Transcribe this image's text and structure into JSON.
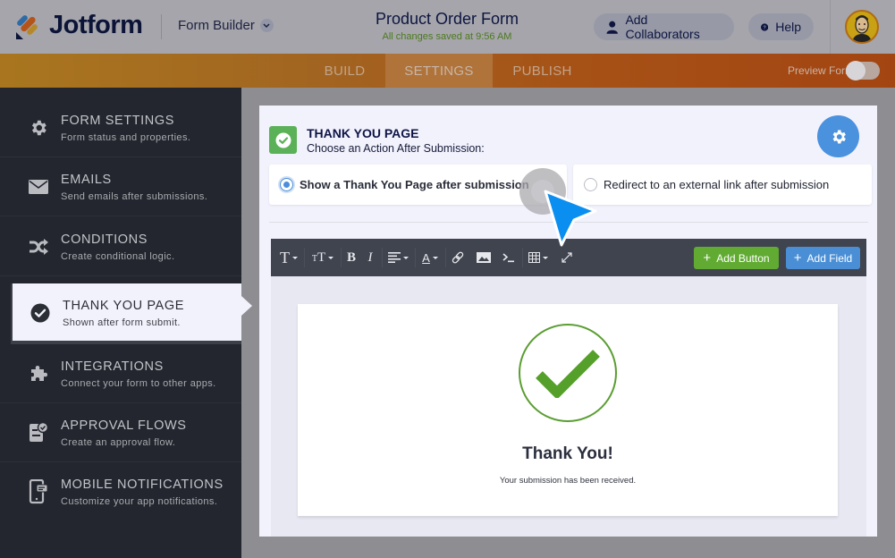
{
  "header": {
    "brand": "Jotform",
    "builder_label": "Form Builder",
    "form_title": "Product Order Form",
    "save_status": "All changes saved at 9:56 AM",
    "collaborators_label": "Add Collaborators",
    "help_label": "Help"
  },
  "tabs": [
    {
      "label": "BUILD",
      "active": false
    },
    {
      "label": "SETTINGS",
      "active": true
    },
    {
      "label": "PUBLISH",
      "active": false
    }
  ],
  "preview": {
    "label": "Preview Form",
    "enabled": false
  },
  "sidebar": {
    "items": [
      {
        "label": "FORM SETTINGS",
        "sub": "Form status and properties.",
        "icon": "gear-icon",
        "active": false
      },
      {
        "label": "EMAILS",
        "sub": "Send emails after submissions.",
        "icon": "envelope-icon",
        "active": false
      },
      {
        "label": "CONDITIONS",
        "sub": "Create conditional logic.",
        "icon": "shuffle-icon",
        "active": false
      },
      {
        "label": "THANK YOU PAGE",
        "sub": "Shown after form submit.",
        "icon": "check-circle-icon",
        "active": true
      },
      {
        "label": "INTEGRATIONS",
        "sub": "Connect your form to other apps.",
        "icon": "puzzle-icon",
        "active": false
      },
      {
        "label": "APPROVAL FLOWS",
        "sub": "Create an approval flow.",
        "icon": "approval-icon",
        "active": false
      },
      {
        "label": "MOBILE NOTIFICATIONS",
        "sub": "Customize your app notifications.",
        "icon": "mobile-icon",
        "active": false
      }
    ]
  },
  "panel": {
    "title": "THANK YOU PAGE",
    "subtitle": "Choose an Action After Submission:",
    "options": [
      {
        "label": "Show a Thank You Page after submission",
        "selected": true
      },
      {
        "label": "Redirect to an external link after submission",
        "selected": false
      }
    ],
    "toolbar": {
      "tools": [
        "font-family",
        "font-size",
        "bold",
        "italic",
        "align",
        "text-color",
        "link",
        "image",
        "code",
        "table",
        "fullscreen"
      ],
      "add_button_label": "Add Button",
      "add_field_label": "Add Field"
    },
    "preview": {
      "heading": "Thank You!",
      "message": "Your submission has been received."
    }
  },
  "colors": {
    "accent_orange": "#f5821f",
    "success_green": "#5bb157",
    "primary_blue": "#4a91de",
    "sidebar_bg": "#23262e"
  }
}
